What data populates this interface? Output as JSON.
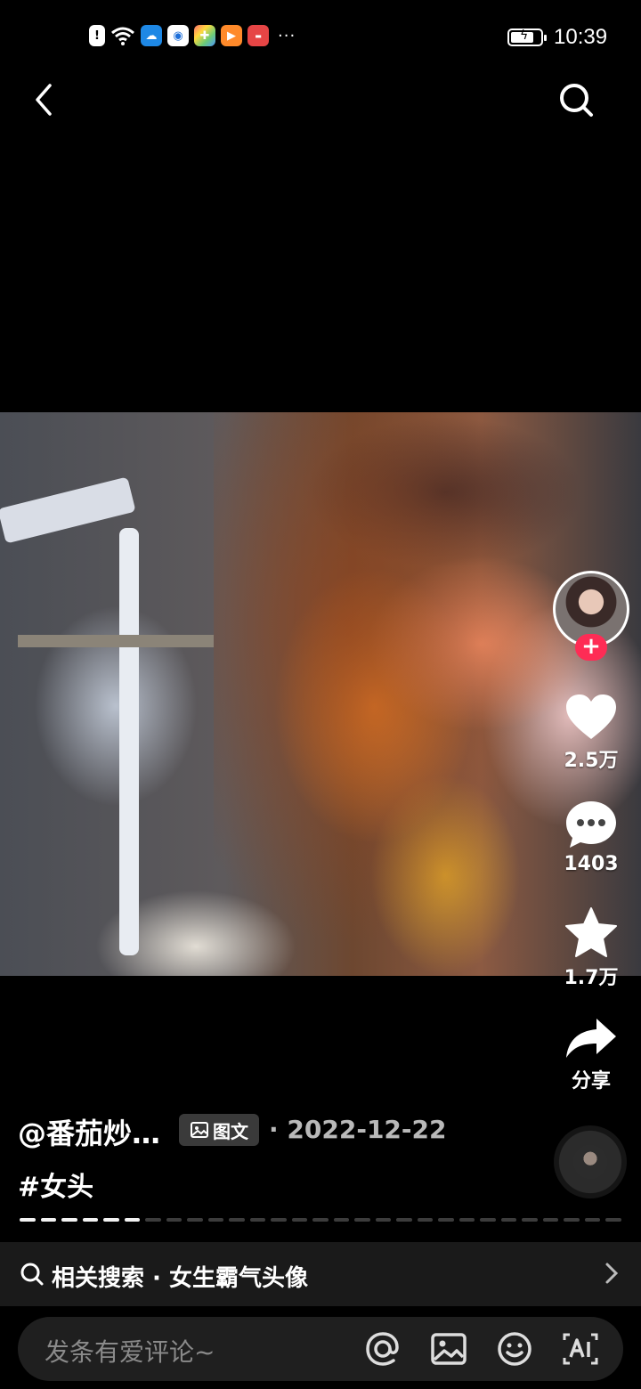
{
  "status_bar": {
    "time": "10:39",
    "overflow": "···",
    "icons": [
      "alert-icon",
      "wifi-icon",
      "weather-icon",
      "browser-icon",
      "app-icon",
      "video-icon",
      "huawei-icon"
    ],
    "battery_level": 0.7
  },
  "post": {
    "author": "@番茄炒…",
    "type_badge": "图文",
    "date": "2022-12-22",
    "date_sep": "·",
    "hashtag": "#女头",
    "pages_total": 29,
    "pages_active": 6
  },
  "actions": {
    "follow": "+",
    "likes": "2.5万",
    "comments": "1403",
    "favorites": "1.7万",
    "share": "分享"
  },
  "related_search": {
    "label": "相关搜索 · 女生霸气头像"
  },
  "comment_bar": {
    "placeholder": "发条有爱评论~"
  },
  "colors": {
    "follow": "#fe2c55",
    "background": "#000000"
  }
}
